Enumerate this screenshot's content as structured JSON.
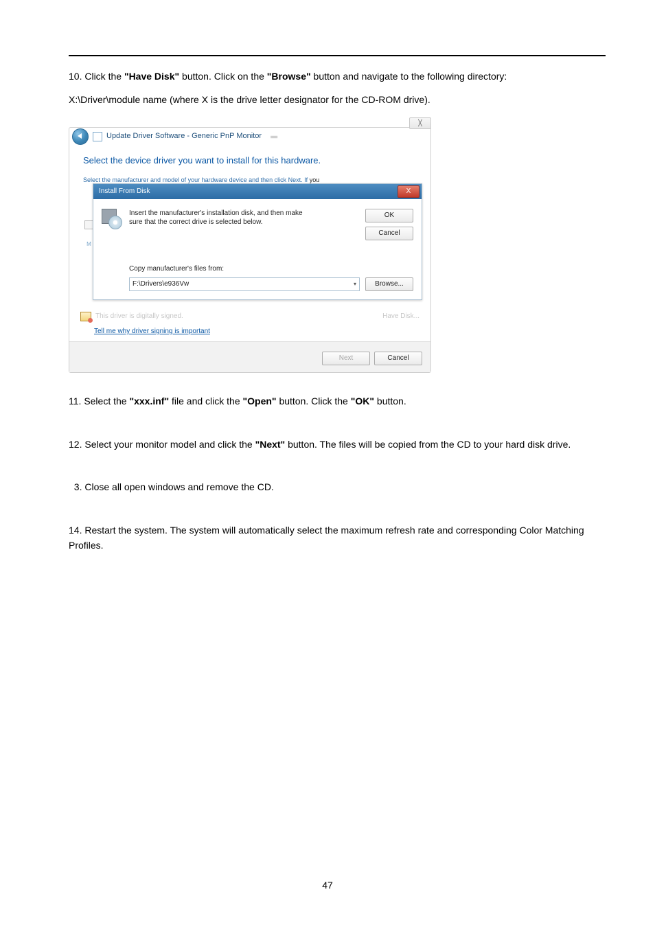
{
  "step10": {
    "prefix": "10. Click the ",
    "b1": "\"Have Disk\"",
    "mid1": " button. Click on the ",
    "b2": "\"Browse\"",
    "mid2": " button and navigate to the following directory:",
    "line2": "X:\\Driver\\module name   (where X is the drive letter designator for the CD-ROM drive)."
  },
  "screenshot": {
    "topGhost": "",
    "closeGlyph": "╳",
    "address": "Update Driver Software - Generic PnP Monitor",
    "heading": "Select the device driver you want to install for this hardware.",
    "tinyCut": "Select the manufacturer and model of your hardware device and then click Next. If ",
    "tinyCutTail": "you",
    "ifdTitle": "Install From Disk",
    "ifdX": "X",
    "ifdMsg1": "Insert the manufacturer's installation disk, and then make",
    "ifdMsg2": "sure that the correct drive is selected below.",
    "ok": "OK",
    "cancel": "Cancel",
    "copyLabel": "Copy manufacturer's files from:",
    "path": "F:\\Drivers\\e936Vw",
    "dd": "▾",
    "browse": "Browse...",
    "leftGhostM": "M",
    "sigText": "This driver is digitally signed.",
    "haveDisk": "Have Disk...",
    "tellMe": "Tell me why driver signing is important",
    "next": "Next",
    "cancel2": "Cancel"
  },
  "step11": {
    "p1": "11. Select the ",
    "b1": "\"xxx.inf\"",
    "p2": " file and click the ",
    "b2": "\"Open\"",
    "p3": " button. Click the ",
    "b3": "\"OK\"",
    "p4": " button."
  },
  "step12": {
    "p1": "12. Select your monitor model and click the ",
    "b1": "\"Next\"",
    "p2": " button. The files will be copied from the CD to your hard disk drive."
  },
  "step13": "  3. Close all open windows and remove the CD.",
  "step14": "14. Restart the system. The system will automatically select the maximum refresh rate and corresponding Color Matching Profiles.",
  "pageNumber": "47"
}
